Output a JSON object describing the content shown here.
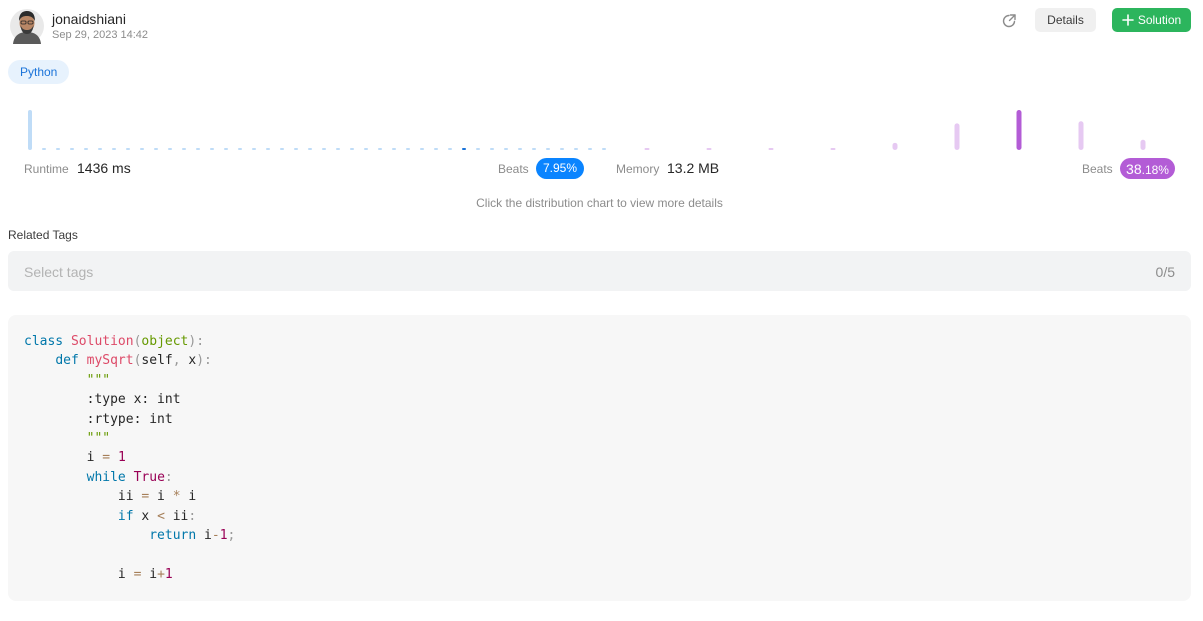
{
  "header": {
    "username": "jonaidshiani",
    "timestamp": "Sep 29, 2023 14:42",
    "details_label": "Details",
    "solution_label": "Solution"
  },
  "language": "Python",
  "stats": {
    "runtime_label": "Runtime",
    "runtime_value": "1436 ms",
    "runtime_beats_label": "Beats",
    "runtime_beats": "7.95%",
    "memory_label": "Memory",
    "memory_value": "13.2 MB",
    "memory_beats_label": "Beats",
    "memory_beats_int": "38",
    "memory_beats_frac": ".18%"
  },
  "hint": "Click the distribution chart to view more details",
  "related_tags": {
    "title": "Related Tags",
    "placeholder": "Select tags",
    "count": "0/5"
  },
  "colors": {
    "runtime_bar": "#bfdcf7",
    "runtime_selected": "#1a73d9",
    "memory_bar": "#e6c9f2",
    "memory_selected": "#b35cd6",
    "solution_green": "#2cb55d"
  },
  "chart_data": [
    {
      "type": "bar",
      "series": [
        {
          "values": [
            40,
            1,
            1,
            1,
            1,
            1,
            1,
            1,
            1,
            1,
            1,
            1,
            1,
            1,
            1,
            1,
            1,
            1,
            1,
            1,
            1,
            1,
            1,
            1,
            1,
            1,
            1,
            1,
            1,
            1,
            1,
            1,
            1,
            1,
            1,
            1,
            1,
            1,
            1,
            1,
            1,
            1
          ]
        }
      ],
      "selected_index": 31
    },
    {
      "type": "bar",
      "series": [
        {
          "values": [
            1,
            1,
            1,
            1,
            7,
            26,
            39,
            28,
            10
          ]
        }
      ],
      "selected_index": 6
    }
  ],
  "code": {
    "lines": [
      [
        [
          "kw",
          "class"
        ],
        [
          "p",
          " "
        ],
        [
          "fn",
          "Solution"
        ],
        [
          "pn",
          "("
        ],
        [
          "str",
          "object"
        ],
        [
          "pn",
          "):"
        ]
      ],
      [
        [
          "p",
          "    "
        ],
        [
          "kw",
          "def"
        ],
        [
          "p",
          " "
        ],
        [
          "fn",
          "mySqrt"
        ],
        [
          "pn",
          "("
        ],
        [
          "p",
          "self"
        ],
        [
          "pn",
          ","
        ],
        [
          "p",
          " x"
        ],
        [
          "pn",
          "):"
        ]
      ],
      [
        [
          "p",
          "        "
        ],
        [
          "str",
          "\"\"\""
        ]
      ],
      [
        [
          "p",
          "        :type x: int"
        ]
      ],
      [
        [
          "p",
          "        :rtype: int"
        ]
      ],
      [
        [
          "p",
          "        "
        ],
        [
          "str",
          "\"\"\""
        ]
      ],
      [
        [
          "p",
          "        i "
        ],
        [
          "op",
          "="
        ],
        [
          "p",
          " "
        ],
        [
          "num",
          "1"
        ]
      ],
      [
        [
          "p",
          "        "
        ],
        [
          "kw",
          "while"
        ],
        [
          "p",
          " "
        ],
        [
          "blt",
          "True"
        ],
        [
          "pn",
          ":"
        ]
      ],
      [
        [
          "p",
          "            ii "
        ],
        [
          "op",
          "="
        ],
        [
          "p",
          " i "
        ],
        [
          "op",
          "*"
        ],
        [
          "p",
          " i"
        ]
      ],
      [
        [
          "p",
          "            "
        ],
        [
          "kw",
          "if"
        ],
        [
          "p",
          " x "
        ],
        [
          "op",
          "<"
        ],
        [
          "p",
          " ii"
        ],
        [
          "pn",
          ":"
        ]
      ],
      [
        [
          "p",
          "                "
        ],
        [
          "kw",
          "return"
        ],
        [
          "p",
          " i"
        ],
        [
          "op",
          "-"
        ],
        [
          "num",
          "1"
        ],
        [
          "pn",
          ";"
        ]
      ],
      [
        [
          "p",
          ""
        ]
      ],
      [
        [
          "p",
          "            i "
        ],
        [
          "op",
          "="
        ],
        [
          "p",
          " i"
        ],
        [
          "op",
          "+"
        ],
        [
          "num",
          "1"
        ]
      ]
    ]
  }
}
